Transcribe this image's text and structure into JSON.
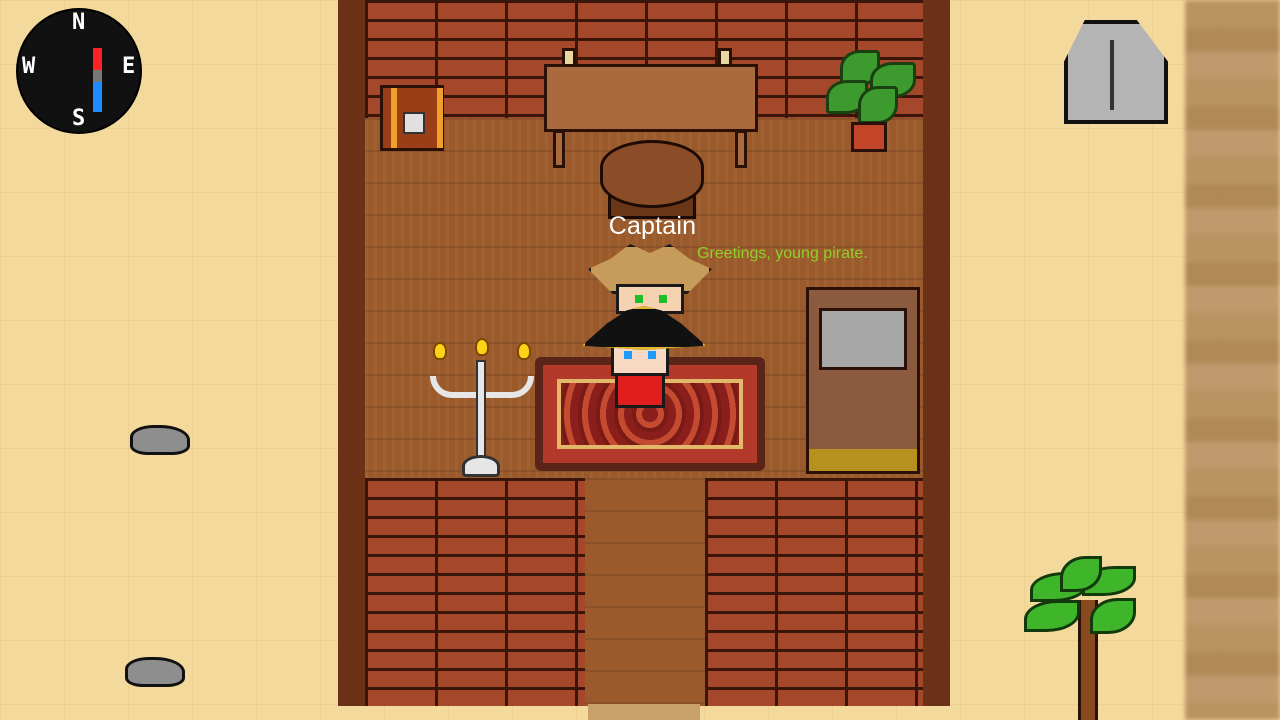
{
  "compass": {
    "north": "N",
    "south": "S",
    "east": "E",
    "west": "W"
  },
  "npc": {
    "name": "Captain",
    "speech": "Greetings, young pirate."
  },
  "colors": {
    "speech_text": "#8fd12a",
    "name_text": "#ffffff",
    "sand": "#f4d99c",
    "brick": "#a5472a",
    "floor": "#9a5a2c"
  },
  "icons": [
    "compass-icon",
    "rock-icon",
    "pebble-icon",
    "palm-tree-icon",
    "treasure-chest-icon",
    "potted-plant-icon",
    "candelabra-icon",
    "bed-icon",
    "rug-icon",
    "table-icon",
    "stool-icon"
  ]
}
